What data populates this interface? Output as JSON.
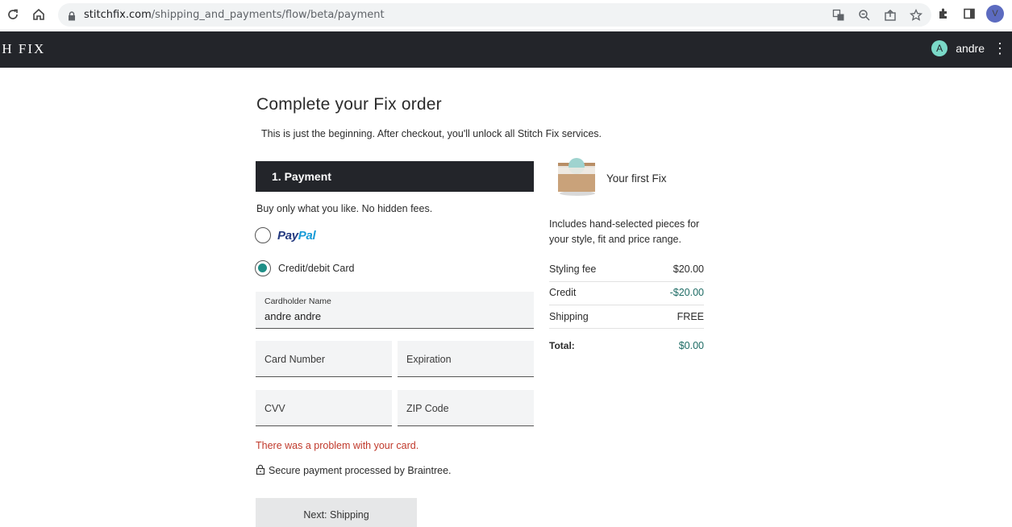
{
  "browser": {
    "url_host": "stitchfix.com",
    "url_path": "/shipping_and_payments/flow/beta/payment",
    "profile_initial": "V"
  },
  "header": {
    "brand": "CH FIX",
    "user_initial": "A",
    "user_name": "andre"
  },
  "main": {
    "title": "Complete your Fix order",
    "subtitle": "This is just the beginning. After checkout, you'll unlock all Stitch Fix services.",
    "section_title": "1. Payment",
    "fees_text": "Buy only what you like. No hidden fees.",
    "paypal": {
      "pay": "Pay",
      "pal": "Pal"
    },
    "card_option_label": "Credit/debit Card",
    "fields": {
      "cardholder": {
        "label": "Cardholder Name",
        "value": "andre andre"
      },
      "card_number": {
        "label": "Card Number"
      },
      "expiration": {
        "label": "Expiration"
      },
      "cvv": {
        "label": "CVV"
      },
      "zip": {
        "label": "ZIP Code"
      }
    },
    "error": "There was a problem with your card.",
    "secure_text": "Secure payment processed by Braintree.",
    "next_button": "Next: Shipping"
  },
  "summary": {
    "title": "Your first Fix",
    "description": "Includes hand-selected pieces for your style, fit and price range.",
    "rows": [
      {
        "label": "Styling fee",
        "value": "$20.00"
      },
      {
        "label": "Credit",
        "value": "-$20.00"
      },
      {
        "label": "Shipping",
        "value": "FREE"
      }
    ],
    "total_label": "Total:",
    "total_value": "$0.00"
  },
  "colors": {
    "header_bg": "#23252a",
    "teal": "#1f8f87",
    "error": "#c0392b"
  }
}
